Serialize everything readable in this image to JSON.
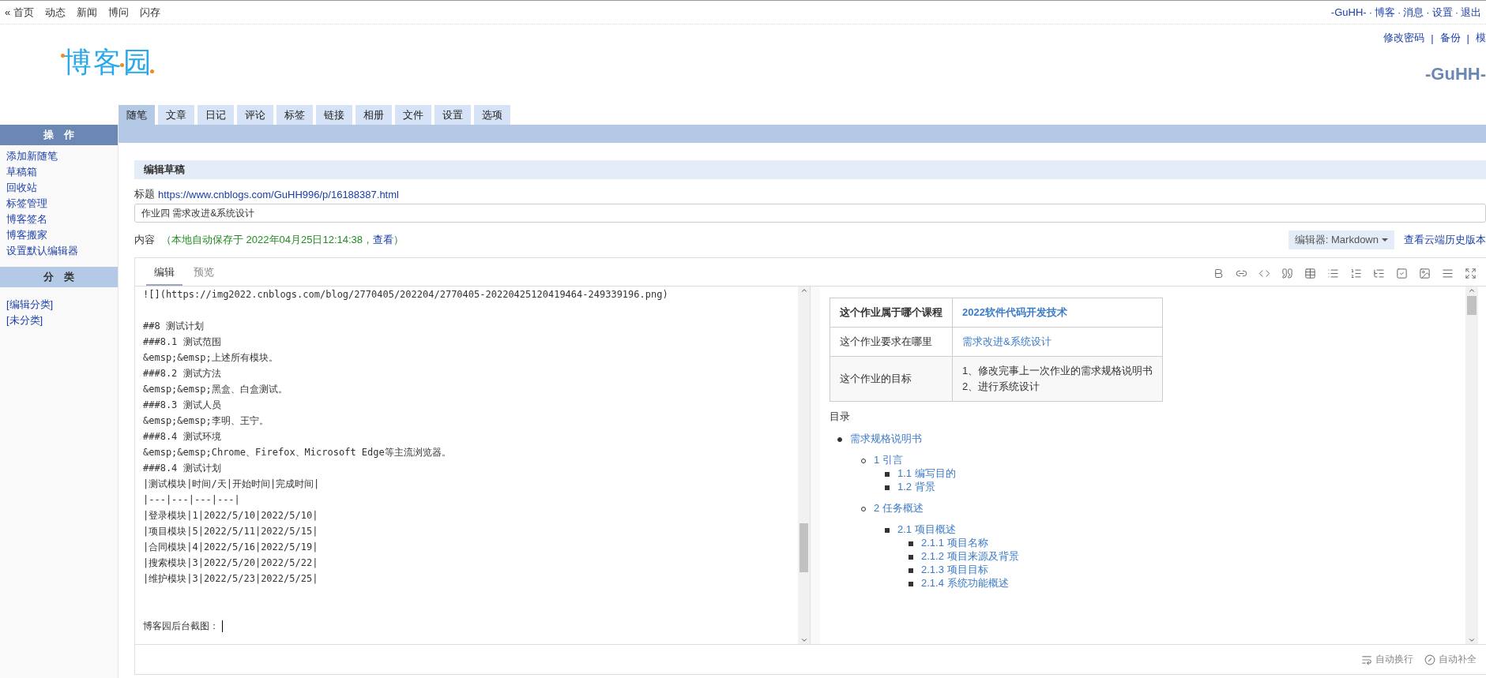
{
  "top_nav": {
    "left_links": [
      "« 首页",
      "动态",
      "新闻",
      "博问",
      "闪存"
    ],
    "right_links": [
      "-GuHH-",
      "博客",
      "消息",
      "设置",
      "退出"
    ],
    "separator": "·"
  },
  "header": {
    "logo": "博客园",
    "account_links": [
      "修改密码",
      "备份",
      "模"
    ],
    "separator": "|",
    "blog_title": "-GuHH-"
  },
  "tabs": [
    {
      "label": "随笔",
      "selected": true
    },
    {
      "label": "文章",
      "selected": false
    },
    {
      "label": "日记",
      "selected": false
    },
    {
      "label": "评论",
      "selected": false
    },
    {
      "label": "标签",
      "selected": false
    },
    {
      "label": "链接",
      "selected": false
    },
    {
      "label": "相册",
      "selected": false
    },
    {
      "label": "文件",
      "selected": false
    },
    {
      "label": "设置",
      "selected": false
    },
    {
      "label": "选项",
      "selected": false
    }
  ],
  "sidebar": {
    "sections": [
      {
        "title": "操　作",
        "kind": "dark",
        "items": [
          "添加新随笔",
          "草稿箱",
          "回收站",
          "标签管理",
          "博客签名",
          "博客搬家",
          "设置默认编辑器"
        ]
      },
      {
        "title": "分　类",
        "kind": "light",
        "items": [
          "[编辑分类]",
          "[未分类]"
        ]
      }
    ]
  },
  "panel_title": "编辑草稿",
  "title_field": {
    "label": "标题",
    "link": "https://www.cnblogs.com/GuHH996/p/16188387.html",
    "value": "作业四 需求改进&系统设计"
  },
  "content_row": {
    "label": "内容",
    "autosave_text": "（本地自动保存于 2022年04月25日12:14:38，",
    "autosave_link": "查看",
    "autosave_end": "）",
    "editor_select": "编辑器: Markdown",
    "history_link": "查看云端历史版本"
  },
  "editor": {
    "tabs": [
      {
        "label": "编辑",
        "selected": true
      },
      {
        "label": "预览",
        "selected": false
      }
    ],
    "lines": [
      {
        "text": "![](https://img2022.cnblogs.com/blog/2770405/202204/2770405-20220425120419464-249339196.png)",
        "kind": "plain",
        "cursor": false
      },
      {
        "text": "##8 测试计划",
        "kind": "after_blank",
        "cursor": false
      },
      {
        "text": "###8.1 测试范围",
        "kind": "plain",
        "cursor": false
      },
      {
        "text": "&emsp;&emsp;上述所有模块。",
        "kind": "plain",
        "cursor": false
      },
      {
        "text": "###8.2 测试方法",
        "kind": "plain",
        "cursor": false
      },
      {
        "text": "&emsp;&emsp;黑盒、白盒测试。",
        "kind": "plain",
        "cursor": false
      },
      {
        "text": "###8.3 测试人员",
        "kind": "plain",
        "cursor": false
      },
      {
        "text": "&emsp;&emsp;李明、王宁。",
        "kind": "plain",
        "cursor": false
      },
      {
        "text": "###8.4 测试环境",
        "kind": "plain",
        "cursor": false
      },
      {
        "text": "&emsp;&emsp;Chrome、Firefox、Microsoft Edge等主流浏览器。",
        "kind": "plain",
        "cursor": false
      },
      {
        "text": "###8.4 测试计划",
        "kind": "plain",
        "cursor": false
      },
      {
        "text": "|测试模块|时间/天|开始时间|完成时间|",
        "kind": "plain",
        "cursor": false
      },
      {
        "text": "|---|---|---|---|",
        "kind": "plain",
        "cursor": false
      },
      {
        "text": "|登录模块|1|2022/5/10|2022/5/10|",
        "kind": "plain",
        "cursor": false
      },
      {
        "text": "|项目模块|5|2022/5/11|2022/5/15|",
        "kind": "plain",
        "cursor": false
      },
      {
        "text": "|合同模块|4|2022/5/16|2022/5/19|",
        "kind": "plain",
        "cursor": false
      },
      {
        "text": "|搜索模块|3|2022/5/20|2022/5/22|",
        "kind": "plain",
        "cursor": false
      },
      {
        "text": "|维护模块|3|2022/5/23|2022/5/25|",
        "kind": "plain",
        "cursor": false
      },
      {
        "text": "博客园后台截图：",
        "kind": "after_two_blanks",
        "cursor": true
      }
    ],
    "status": [
      "自动换行",
      "自动补全"
    ]
  },
  "preview": {
    "table": [
      {
        "label": "这个作业属于哪个课程",
        "kind": "header",
        "value": [
          "2022软件代码开发技术"
        ],
        "link": true
      },
      {
        "label": "这个作业要求在哪里",
        "kind": "row",
        "value": [
          "需求改进&系统设计"
        ],
        "link": true
      },
      {
        "label": "这个作业的目标",
        "kind": "row",
        "value": [
          "1、修改完事上一次作业的需求规格说明书",
          "2、进行系统设计"
        ],
        "link": false
      }
    ],
    "toc_title": "目录",
    "toc": [
      {
        "label": "需求规格说明书",
        "children": [
          {
            "label": "1 引言",
            "children": [
              {
                "label": "1.1 编写目的"
              },
              {
                "label": "1.2 背景"
              }
            ]
          },
          {
            "label": "2 任务概述",
            "children": [
              {
                "label": "2.1 项目概述",
                "children": [
                  {
                    "label": "2.1.1 项目名称"
                  },
                  {
                    "label": "2.1.2 项目来源及背景"
                  },
                  {
                    "label": "2.1.3 项目目标"
                  },
                  {
                    "label": "2.1.4 系统功能概述"
                  }
                ]
              }
            ]
          }
        ]
      }
    ]
  }
}
